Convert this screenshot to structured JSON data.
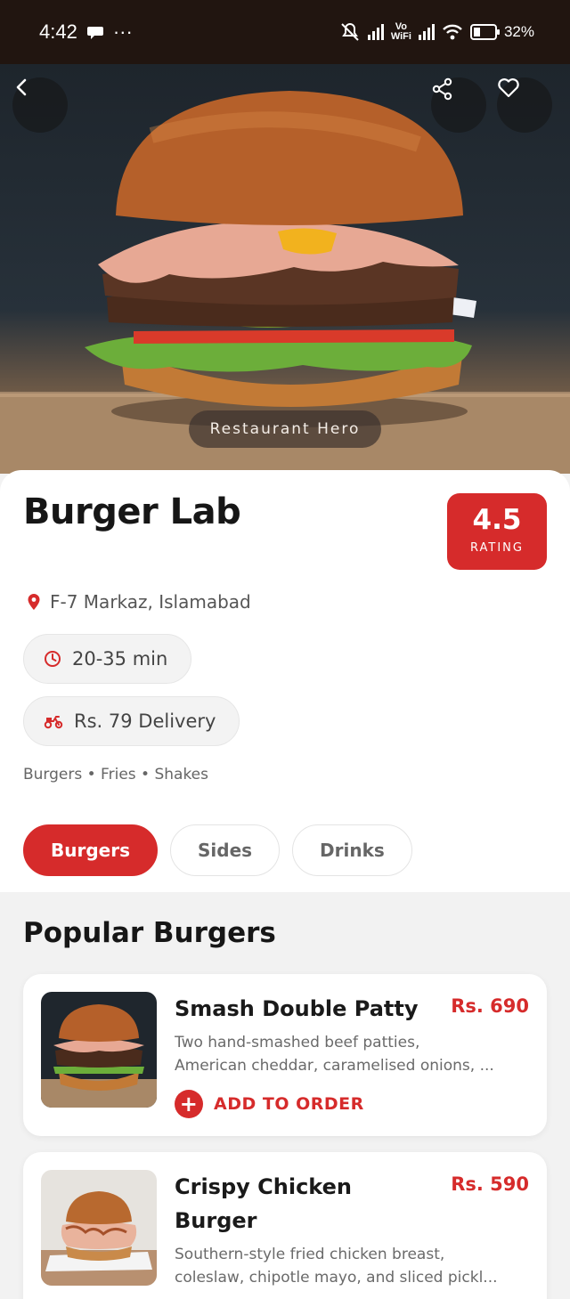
{
  "status_bar": {
    "time": "4:42",
    "dots": "···",
    "wifi_label_top": "Vo",
    "wifi_label_bottom": "WiFi",
    "battery": "32%",
    "battery_level": 0.32
  },
  "hero": {
    "caption": "Restaurant Hero",
    "back_icon": "back-arrow-icon",
    "share_icon": "share-icon",
    "favorite_icon": "heart-icon"
  },
  "restaurant": {
    "name": "Burger Lab",
    "rating_value": "4.5",
    "rating_label": "RATING",
    "location": "F-7 Markaz, Islamabad",
    "delivery_time": "20-35 min",
    "delivery_fee": "Rs. 79 Delivery",
    "cuisines": "Burgers • Fries • Shakes"
  },
  "tabs": [
    {
      "label": "Burgers",
      "active": true
    },
    {
      "label": "Sides",
      "active": false
    },
    {
      "label": "Drinks",
      "active": false
    }
  ],
  "section": {
    "title": "Popular Burgers"
  },
  "menu_items": [
    {
      "title": "Smash Double Patty",
      "price": "Rs. 690",
      "desc_line1": "Two hand-smashed beef patties,",
      "desc_line2": "American cheddar, caramelised onions, ...",
      "action": "ADD TO ORDER"
    },
    {
      "title": "Crispy Chicken Burger",
      "title_line1": "Crispy Chicken",
      "title_line2": "Burger",
      "price": "Rs. 590",
      "desc_line1": "Southern-style fried chicken breast,",
      "desc_line2": "coleslaw, chipotle mayo, and sliced pickl..."
    }
  ],
  "colors": {
    "accent": "#d62b2b",
    "status_bar": "#211510",
    "background": "#f2f2f2"
  }
}
